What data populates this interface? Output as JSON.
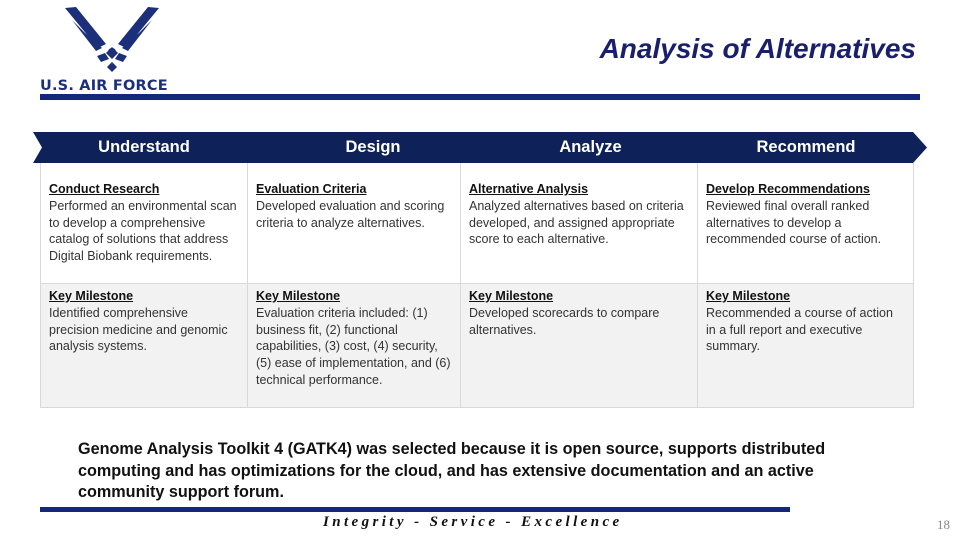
{
  "header": {
    "logo_text": "U.S. AIR FORCE",
    "title": "Analysis of Alternatives"
  },
  "colors": {
    "brand_navy": "#13287a",
    "phase_bar": "#0e2259",
    "row2_bg": "#f2f2f2"
  },
  "phases": [
    {
      "label": "Understand"
    },
    {
      "label": "Design"
    },
    {
      "label": "Analyze"
    },
    {
      "label": "Recommend"
    }
  ],
  "table": {
    "rows": [
      [
        {
          "heading": "Conduct Research",
          "body": "Performed an environmental scan to develop a comprehensive catalog of solutions that address Digital Biobank requirements."
        },
        {
          "heading": "Evaluation Criteria",
          "body": "Developed evaluation and scoring criteria to analyze alternatives."
        },
        {
          "heading": "Alternative Analysis",
          "body": "Analyzed alternatives based on criteria developed, and assigned appropriate score to each alternative."
        },
        {
          "heading": "Develop Recommendations",
          "body": "Reviewed final overall ranked alternatives to develop a recommended course of action."
        }
      ],
      [
        {
          "heading": "Key Milestone",
          "body": "Identified comprehensive precision medicine and genomic analysis systems."
        },
        {
          "heading": "Key Milestone",
          "body": "Evaluation criteria included: (1) business fit, (2) functional capabilities, (3) cost, (4) security, (5) ease of implementation, and (6) technical performance."
        },
        {
          "heading": "Key Milestone",
          "body": "Developed scorecards to compare alternatives."
        },
        {
          "heading": "Key Milestone",
          "body": "Recommended a course of action in a full report and executive summary."
        }
      ]
    ]
  },
  "summary": "Genome Analysis Toolkit 4 (GATK4) was selected because it is open source, supports distributed computing and has optimizations for the cloud, and has extensive documentation and an active community support forum.",
  "footer": {
    "motto": "Integrity - Service - Excellence",
    "page_number": "18"
  }
}
